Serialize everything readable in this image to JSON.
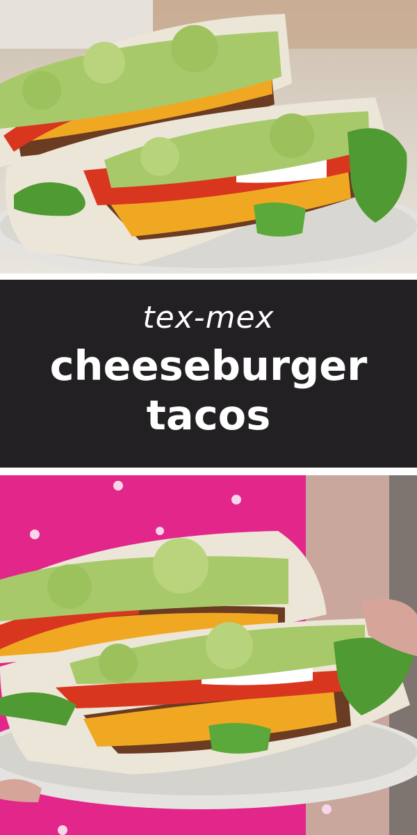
{
  "banner": {
    "subtitle": "tex-mex",
    "title_line1": "cheeseburger",
    "title_line2": "tacos"
  },
  "colors": {
    "banner_background": "#232023",
    "banner_text": "#ffffff",
    "tortilla": "#ece6d8",
    "guacamole": "#a8c96a",
    "tomato": "#d9361f",
    "cheese": "#f0a822",
    "beef": "#6b3b22",
    "lettuce": "#4f9a32",
    "shirt": "#e2268a"
  },
  "photos": {
    "top": "plated-cheeseburger-tacos",
    "bottom": "hand-holding-plate-of-tacos"
  }
}
